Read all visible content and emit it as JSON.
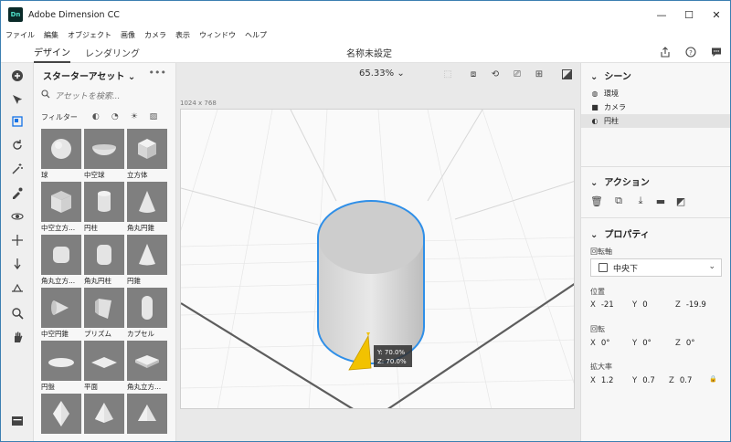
{
  "app": {
    "name": "Adobe Dimension CC",
    "logo_text": "Dn"
  },
  "window_buttons": {
    "minimize": "—",
    "maximize": "☐",
    "close": "✕"
  },
  "menu": [
    "ファイル",
    "編集",
    "オブジェクト",
    "画像",
    "カメラ",
    "表示",
    "ウィンドウ",
    "ヘルプ"
  ],
  "tabs": {
    "design": "デザイン",
    "render": "レンダリング"
  },
  "document_title": "名称未設定",
  "assets": {
    "header": "スターターアセット",
    "search_placeholder": "アセットを検索...",
    "filter_label": "フィルター",
    "items": [
      {
        "label": "球",
        "shape": "sphere"
      },
      {
        "label": "中空球",
        "shape": "bowl"
      },
      {
        "label": "立方体",
        "shape": "cube"
      },
      {
        "label": "中空立方...",
        "shape": "hollow-cube"
      },
      {
        "label": "円柱",
        "shape": "cylinder"
      },
      {
        "label": "角丸円錐",
        "shape": "rounded-cone"
      },
      {
        "label": "角丸立方...",
        "shape": "rounded-cube"
      },
      {
        "label": "角丸円柱",
        "shape": "rounded-cylinder"
      },
      {
        "label": "円錐",
        "shape": "cone"
      },
      {
        "label": "中空円錐",
        "shape": "hollow-cone"
      },
      {
        "label": "プリズム",
        "shape": "prism"
      },
      {
        "label": "カプセル",
        "shape": "capsule"
      },
      {
        "label": "円盤",
        "shape": "disc"
      },
      {
        "label": "平面",
        "shape": "plane"
      },
      {
        "label": "角丸立方...",
        "shape": "rounded-slab"
      },
      {
        "label": "",
        "shape": "octahedron"
      },
      {
        "label": "",
        "shape": "pyramid"
      },
      {
        "label": "",
        "shape": "tetra"
      }
    ]
  },
  "canvas": {
    "zoom": "65.33%",
    "dimensions": "1024 x 768",
    "gizmo_y": "Y: 70.0%",
    "gizmo_z": "Z: 70.0%"
  },
  "scene": {
    "header": "シーン",
    "items": [
      {
        "label": "環境",
        "icon": "globe-icon"
      },
      {
        "label": "カメラ",
        "icon": "camera-icon"
      },
      {
        "label": "円柱",
        "icon": "shape-icon",
        "selected": true
      }
    ]
  },
  "actions": {
    "header": "アクション"
  },
  "properties": {
    "header": "プロパティ",
    "pivot_label": "回転軸",
    "pivot_value": "中央下",
    "position_label": "位置",
    "position": {
      "x": "-21",
      "y": "0",
      "z": "-19.9"
    },
    "rotation_label": "回転",
    "rotation": {
      "x": "0°",
      "y": "0°",
      "z": "0°"
    },
    "scale_label": "拡大率",
    "scale": {
      "x": "1.2",
      "y": "0.7",
      "z": "0.7"
    },
    "axis_labels": {
      "x": "X",
      "y": "Y",
      "z": "Z"
    }
  },
  "colors": {
    "accent": "#1473e6",
    "selection_outline": "#2f8fe8",
    "gizmo": "#f2c200"
  }
}
